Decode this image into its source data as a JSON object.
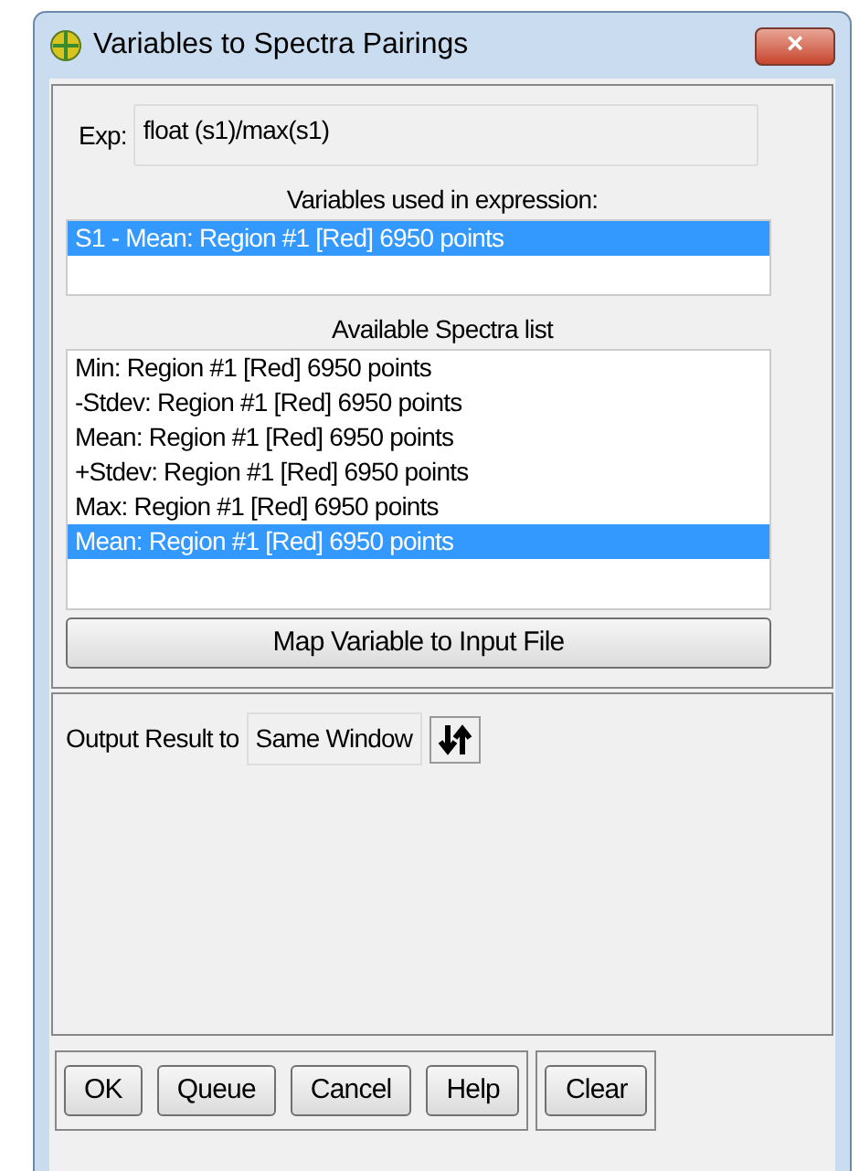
{
  "window": {
    "title": "Variables to Spectra Pairings",
    "close": "×"
  },
  "expression": {
    "label": "Exp:",
    "value": "float (s1)/max(s1)"
  },
  "variables": {
    "label": "Variables used in expression:",
    "items": [
      {
        "text": "S1 - Mean: Region #1 [Red] 6950 points",
        "selected": true
      }
    ]
  },
  "spectra": {
    "label": "Available Spectra list",
    "items": [
      {
        "text": "Min: Region #1 [Red] 6950 points",
        "selected": false
      },
      {
        "text": "-Stdev: Region #1 [Red] 6950 points",
        "selected": false
      },
      {
        "text": "Mean: Region #1 [Red] 6950 points",
        "selected": false
      },
      {
        "text": "+Stdev: Region #1 [Red] 6950 points",
        "selected": false
      },
      {
        "text": "Max: Region #1 [Red] 6950 points",
        "selected": false
      },
      {
        "text": "Mean: Region #1 [Red] 6950 points",
        "selected": true
      }
    ]
  },
  "map_button": "Map Variable to Input File",
  "output": {
    "label": "Output Result to",
    "value": "Same Window"
  },
  "button_groups": [
    [
      "OK",
      "Queue",
      "Cancel",
      "Help"
    ],
    [
      "Clear"
    ]
  ]
}
